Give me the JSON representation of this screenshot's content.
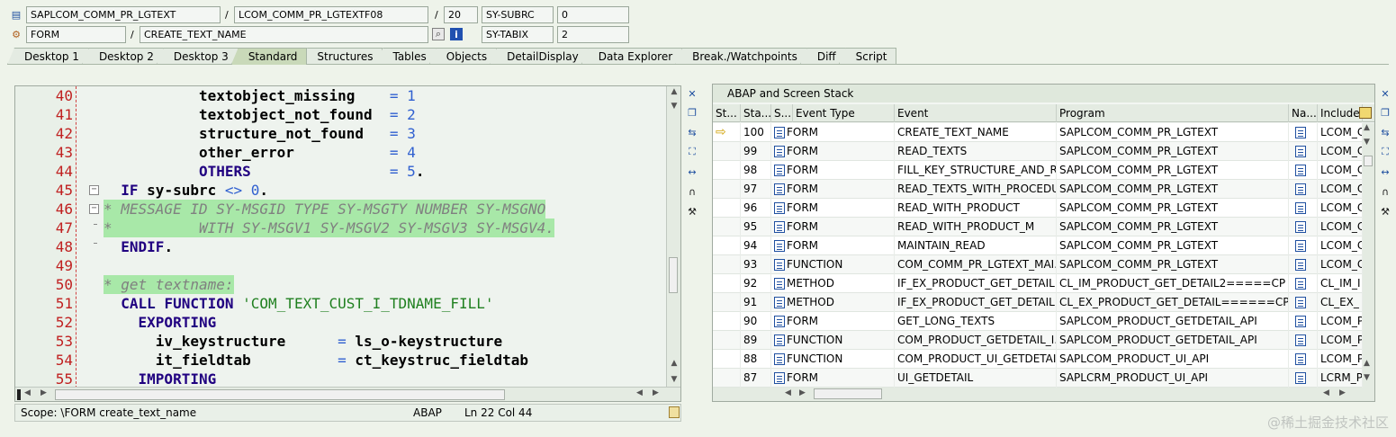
{
  "header": {
    "program": "SAPLCOM_COMM_PR_LGTEXT",
    "include": "LCOM_COMM_PR_LGTEXTF08",
    "line": "20",
    "subrc_label": "SY-SUBRC",
    "subrc_value": "0",
    "event_type": "FORM",
    "event_name": "CREATE_TEXT_NAME",
    "tabix_label": "SY-TABIX",
    "tabix_value": "2",
    "slash": "/"
  },
  "tabs": [
    "Desktop 1",
    "Desktop 2",
    "Desktop 3",
    "Standard",
    "Structures",
    "Tables",
    "Objects",
    "DetailDisplay",
    "Data Explorer",
    "Break./Watchpoints",
    "Diff",
    "Script"
  ],
  "active_tab": "Standard",
  "editor": {
    "lines": [
      {
        "n": "40",
        "t": "           textobject_missing    = 1"
      },
      {
        "n": "41",
        "t": "           textobject_not_found  = 2"
      },
      {
        "n": "42",
        "t": "           structure_not_found   = 3"
      },
      {
        "n": "43",
        "t": "           other_error           = 4"
      },
      {
        "n": "44",
        "t": "           OTHERS                = 5."
      },
      {
        "n": "45",
        "t": "  IF sy-subrc <> 0."
      },
      {
        "n": "46",
        "t": "* MESSAGE ID SY-MSGID TYPE SY-MSGTY NUMBER SY-MSGNO"
      },
      {
        "n": "47",
        "t": "*          WITH SY-MSGV1 SY-MSGV2 SY-MSGV3 SY-MSGV4."
      },
      {
        "n": "48",
        "t": "  ENDIF."
      },
      {
        "n": "49",
        "t": ""
      },
      {
        "n": "50",
        "t": "* get textname:"
      },
      {
        "n": "51",
        "t": "  CALL FUNCTION 'COM_TEXT_CUST_I_TDNAME_FILL'"
      },
      {
        "n": "52",
        "t": "    EXPORTING"
      },
      {
        "n": "53",
        "t": "      iv_keystructure      = ls_o-keystructure"
      },
      {
        "n": "54",
        "t": "      it_fieldtab          = ct_keystruc_fieldtab"
      },
      {
        "n": "55",
        "t": "    IMPORTING"
      }
    ]
  },
  "status": {
    "scope": "Scope: \\FORM create_text_name",
    "lang": "ABAP",
    "pos": "Ln  22 Col 44"
  },
  "stack": {
    "title": "ABAP and Screen Stack",
    "columns": [
      "St...",
      "Sta...",
      "S...",
      "Event Type",
      "Event",
      "Program",
      "Na...",
      "Include"
    ],
    "rows": [
      {
        "sta": "100",
        "type": "FORM",
        "event": "CREATE_TEXT_NAME",
        "program": "SAPLCOM_COMM_PR_LGTEXT",
        "include": "LCOM_C",
        "current": true
      },
      {
        "sta": "99",
        "type": "FORM",
        "event": "READ_TEXTS",
        "program": "SAPLCOM_COMM_PR_LGTEXT",
        "include": "LCOM_C"
      },
      {
        "sta": "98",
        "type": "FORM",
        "event": "FILL_KEY_STRUCTURE_AND_R...",
        "program": "SAPLCOM_COMM_PR_LGTEXT",
        "include": "LCOM_C"
      },
      {
        "sta": "97",
        "type": "FORM",
        "event": "READ_TEXTS_WITH_PROCEDU...",
        "program": "SAPLCOM_COMM_PR_LGTEXT",
        "include": "LCOM_C"
      },
      {
        "sta": "96",
        "type": "FORM",
        "event": "READ_WITH_PRODUCT",
        "program": "SAPLCOM_COMM_PR_LGTEXT",
        "include": "LCOM_C"
      },
      {
        "sta": "95",
        "type": "FORM",
        "event": "READ_WITH_PRODUCT_M",
        "program": "SAPLCOM_COMM_PR_LGTEXT",
        "include": "LCOM_C"
      },
      {
        "sta": "94",
        "type": "FORM",
        "event": "MAINTAIN_READ",
        "program": "SAPLCOM_COMM_PR_LGTEXT",
        "include": "LCOM_C"
      },
      {
        "sta": "93",
        "type": "FUNCTION",
        "event": "COM_COMM_PR_LGTEXT_MAI...",
        "program": "SAPLCOM_COMM_PR_LGTEXT",
        "include": "LCOM_C"
      },
      {
        "sta": "92",
        "type": "METHOD",
        "event": "IF_EX_PRODUCT_GET_DETAIL...",
        "program": "CL_IM_PRODUCT_GET_DETAIL2=====CP",
        "include": "CL_IM_I"
      },
      {
        "sta": "91",
        "type": "METHOD",
        "event": "IF_EX_PRODUCT_GET_DETAIL...",
        "program": "CL_EX_PRODUCT_GET_DETAIL======CP",
        "include": "CL_EX_"
      },
      {
        "sta": "90",
        "type": "FORM",
        "event": "GET_LONG_TEXTS",
        "program": "SAPLCOM_PRODUCT_GETDETAIL_API",
        "include": "LCOM_P"
      },
      {
        "sta": "89",
        "type": "FUNCTION",
        "event": "COM_PRODUCT_GETDETAIL_I...",
        "program": "SAPLCOM_PRODUCT_GETDETAIL_API",
        "include": "LCOM_P"
      },
      {
        "sta": "88",
        "type": "FUNCTION",
        "event": "COM_PRODUCT_UI_GETDETAIL",
        "program": "SAPLCOM_PRODUCT_UI_API",
        "include": "LCOM_P"
      },
      {
        "sta": "87",
        "type": "FORM",
        "event": "UI_GETDETAIL",
        "program": "SAPLCRM_PRODUCT_UI_API",
        "include": "LCRM_P"
      }
    ]
  },
  "watermark": "@稀土掘金技术社区",
  "colors": {
    "accent": "#c9d9b9",
    "highlight": "#a8e8a8",
    "keyword": "#200080",
    "number": "#3060d0",
    "linenum": "#c02020"
  }
}
